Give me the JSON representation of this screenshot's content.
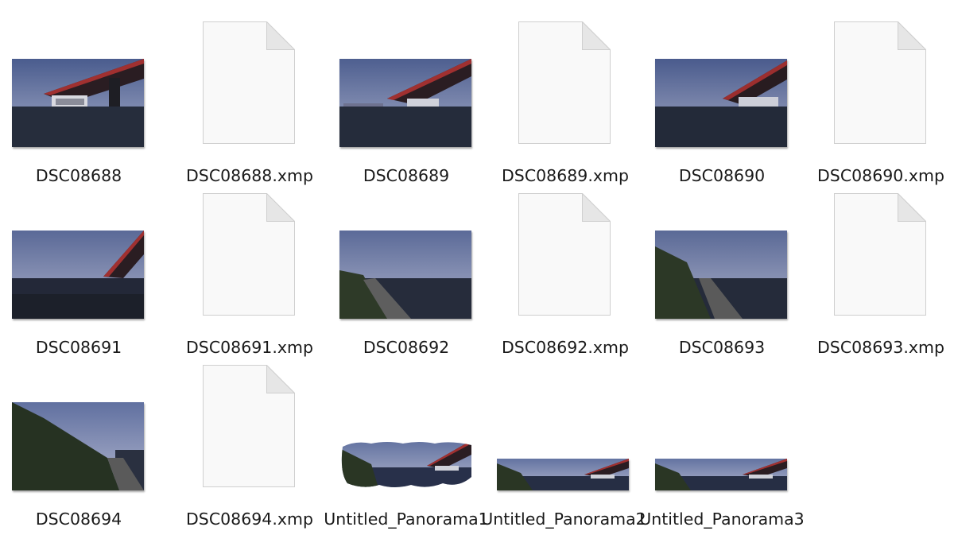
{
  "files": [
    {
      "name": "DSC08688",
      "kind": "photo",
      "scene": "bridge-a"
    },
    {
      "name": "DSC08688.xmp",
      "kind": "document"
    },
    {
      "name": "DSC08689",
      "kind": "photo",
      "scene": "bridge-b"
    },
    {
      "name": "DSC08689.xmp",
      "kind": "document"
    },
    {
      "name": "DSC08690",
      "kind": "photo",
      "scene": "bridge-c"
    },
    {
      "name": "DSC08690.xmp",
      "kind": "document"
    },
    {
      "name": "DSC08691",
      "kind": "photo",
      "scene": "bridge-d"
    },
    {
      "name": "DSC08691.xmp",
      "kind": "document"
    },
    {
      "name": "DSC08692",
      "kind": "photo",
      "scene": "river-bank"
    },
    {
      "name": "DSC08692.xmp",
      "kind": "document"
    },
    {
      "name": "DSC08693",
      "kind": "photo",
      "scene": "river-bank-2"
    },
    {
      "name": "DSC08693.xmp",
      "kind": "document"
    },
    {
      "name": "DSC08694",
      "kind": "photo",
      "scene": "trees"
    },
    {
      "name": "DSC08694.xmp",
      "kind": "document"
    },
    {
      "name": "Untitled_Panorama1",
      "kind": "panorama-warped"
    },
    {
      "name": "Untitled_Panorama2",
      "kind": "panorama"
    },
    {
      "name": "Untitled_Panorama3",
      "kind": "panorama"
    }
  ]
}
